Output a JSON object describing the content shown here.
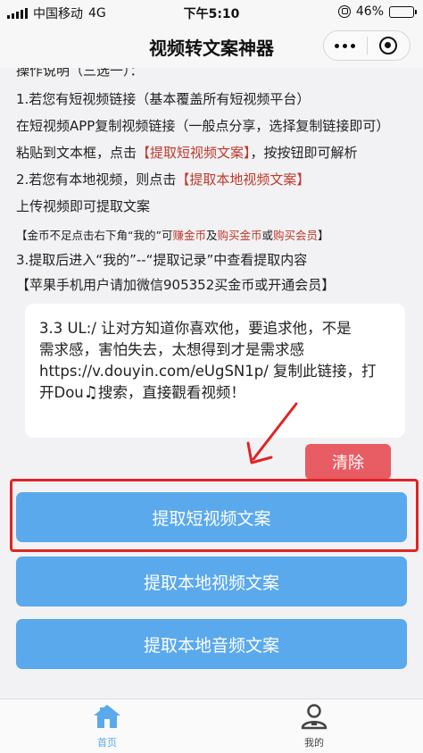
{
  "status_bar": {
    "carrier": "中国移动",
    "network": "4G",
    "time": "下午5:10",
    "battery": "46%",
    "battery_level": 0.46
  },
  "nav": {
    "title": "视频转文案神器"
  },
  "instructions": {
    "header": "操作说明（三选一）：",
    "step1": "1.若您有短视频链接（基本覆盖所有短视频平台）",
    "step1_detail": "在短视频APP复制视频链接（一般点分享，选择复制链接即可）",
    "step1_action_pre": "粘贴到文本框，点击",
    "step1_action_btn": "【提取短视频文案】",
    "step1_action_post": "，按按钮即可解析",
    "step2_pre": "2.若您有本地视频，则点击",
    "step2_btn": "【提取本地视频文案】",
    "step2_detail": "上传视频即可提取文案",
    "coin_note_pre": "【金币不足点击右下角“我的”可",
    "coin_earn": "赚金币",
    "coin_and1": "及",
    "coin_buy": "购买金币",
    "coin_or": "或",
    "coin_member": "购买会员",
    "coin_note_post": "】",
    "step3": "3.提取后进入“我的”--“提取记录”中查看提取内容",
    "apple_note": "【苹果手机用户请加微信905352买金币或开通会员】"
  },
  "link_input": {
    "line1": "3.3 UL:/ 让对方知道你喜欢他，要追求他，不是",
    "line2": "需求感，害怕失去，太想得到才是需求感",
    "line3": "https://v.douyin.com/eUgSN1p/ 复制此链接，打",
    "line4_pre": "开Dou",
    "line4_post": "搜索，直接觀看视频！",
    "note_icon": "music-note-icon"
  },
  "buttons": {
    "clear": "清除",
    "extract_short": "提取短视频文案",
    "extract_local_video": "提取本地视频文案",
    "extract_local_audio": "提取本地音频文案"
  },
  "tabs": [
    {
      "label": "首页",
      "icon": "home-icon"
    },
    {
      "label": "我的",
      "icon": "user-icon"
    }
  ],
  "colors": {
    "primary_button": "#5aa9ec",
    "clear_button": "#e85c63",
    "highlight": "#e02424",
    "link_red": "#c0392b"
  }
}
